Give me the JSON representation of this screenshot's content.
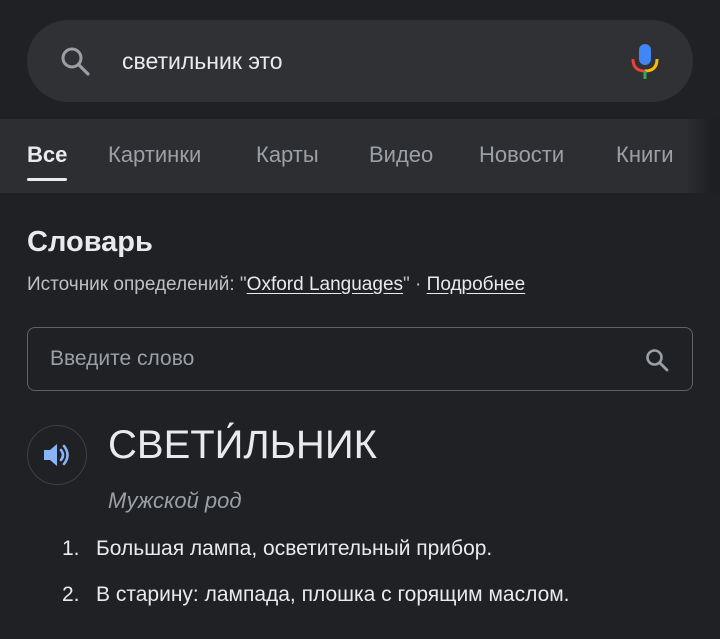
{
  "search": {
    "query": "светильник это",
    "search_icon": "search-icon",
    "mic_icon": "microphone-icon"
  },
  "tabs": [
    {
      "label": "Все",
      "active": true
    },
    {
      "label": "Картинки",
      "active": false
    },
    {
      "label": "Карты",
      "active": false
    },
    {
      "label": "Видео",
      "active": false
    },
    {
      "label": "Новости",
      "active": false
    },
    {
      "label": "Книги",
      "active": false
    }
  ],
  "dictionary": {
    "title": "Словарь",
    "source_prefix": "Источник определений: \"",
    "source_link": "Oxford Languages",
    "source_suffix": "\" · ",
    "more_link": "Подробнее",
    "input_placeholder": "Введите слово",
    "headword": "СВЕТИ́ЛЬНИК",
    "part_of_speech": "Мужской род",
    "senses": [
      {
        "number": "1.",
        "text": "Большая лампа, осветительный прибор."
      },
      {
        "number": "2.",
        "text": "В старину: лампада, плошка с горящим маслом."
      }
    ]
  },
  "colors": {
    "background": "#202124",
    "surface": "#303134",
    "text": "#e8eaed",
    "muted": "#9aa0a6",
    "speaker_blue": "#8ab4f8"
  }
}
